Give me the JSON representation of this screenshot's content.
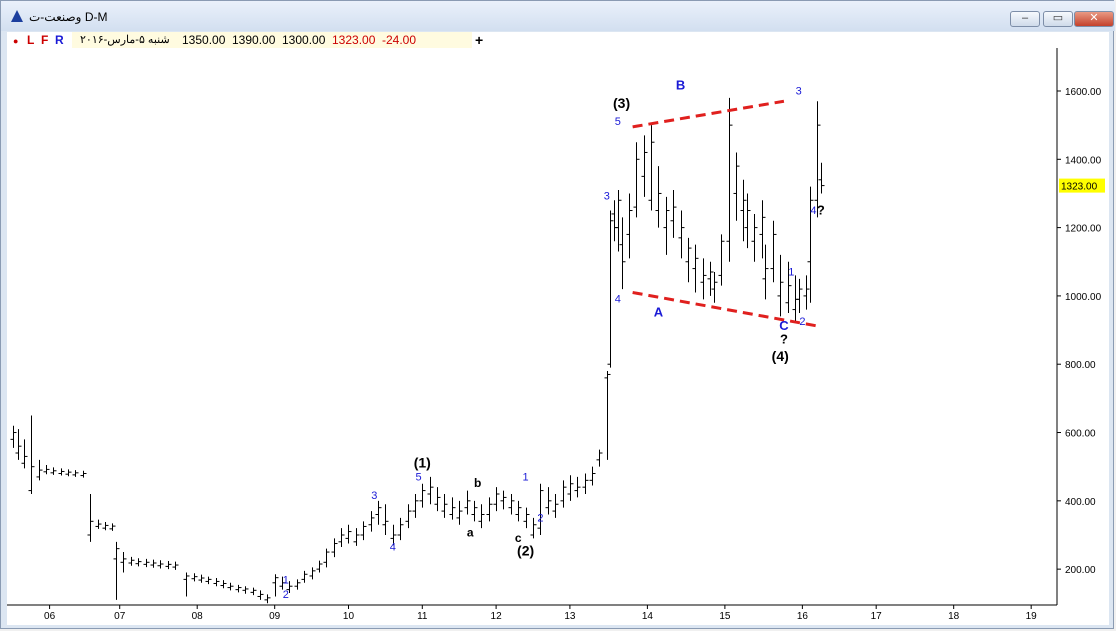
{
  "window": {
    "title": "وصنعت-ت D-M",
    "buttons": [
      "–",
      "▭",
      "✕"
    ]
  },
  "toolbar": {
    "dot": "●",
    "L": "L",
    "F": "F",
    "R": "R",
    "date": "شنبه ۵-مارس-۲۰۱۶",
    "open": "1350.00",
    "high": "1390.00",
    "low": "1300.00",
    "close": "1323.00",
    "change": "-24.00",
    "add": "+"
  },
  "colors": {
    "accent_red": "#cc0000",
    "wave_blue": "#1a1ad6",
    "trendline": "#e0201e",
    "price_tag": "#ffff00"
  },
  "chart_data": {
    "type": "ohlc",
    "y_ticks": [
      200,
      400,
      600,
      800,
      1000,
      1200,
      1400,
      1600
    ],
    "y_tick_labels": [
      "200.00",
      "400.00",
      "600.00",
      "800.00",
      "1000.00",
      "1200.00",
      "1400.00",
      "1600.00"
    ],
    "ylim": [
      95,
      1720
    ],
    "x_ticks": [
      {
        "v": 0.55,
        "label": "06"
      },
      {
        "v": 1.5,
        "label": "07"
      },
      {
        "v": 2.55,
        "label": "08"
      },
      {
        "v": 3.6,
        "label": "09"
      },
      {
        "v": 4.6,
        "label": "10"
      },
      {
        "v": 5.6,
        "label": "11"
      },
      {
        "v": 6.6,
        "label": "12"
      },
      {
        "v": 7.6,
        "label": "13"
      },
      {
        "v": 8.65,
        "label": "14"
      },
      {
        "v": 9.7,
        "label": "15"
      },
      {
        "v": 10.75,
        "label": "16"
      },
      {
        "v": 11.75,
        "label": "17"
      },
      {
        "v": 12.8,
        "label": "18"
      },
      {
        "v": 13.85,
        "label": "19"
      }
    ],
    "last_price": "1323.00",
    "bars": [
      [
        0.05,
        580,
        620,
        555,
        600
      ],
      [
        0.12,
        540,
        610,
        520,
        560
      ],
      [
        0.2,
        510,
        580,
        495,
        530
      ],
      [
        0.3,
        430,
        650,
        420,
        500
      ],
      [
        0.4,
        470,
        520,
        460,
        490
      ],
      [
        0.5,
        485,
        505,
        478,
        492
      ],
      [
        0.6,
        482,
        498,
        476,
        488
      ],
      [
        0.7,
        480,
        495,
        474,
        486
      ],
      [
        0.8,
        478,
        492,
        472,
        484
      ],
      [
        0.9,
        476,
        490,
        470,
        482
      ],
      [
        1.0,
        474,
        488,
        468,
        480
      ],
      [
        1.1,
        300,
        420,
        280,
        340
      ],
      [
        1.2,
        325,
        345,
        318,
        332
      ],
      [
        1.3,
        320,
        338,
        314,
        328
      ],
      [
        1.4,
        318,
        334,
        312,
        326
      ],
      [
        1.45,
        230,
        280,
        110,
        260
      ],
      [
        1.55,
        220,
        250,
        190,
        230
      ],
      [
        1.65,
        218,
        236,
        210,
        226
      ],
      [
        1.75,
        216,
        232,
        208,
        222
      ],
      [
        1.85,
        214,
        230,
        206,
        220
      ],
      [
        1.95,
        212,
        228,
        204,
        218
      ],
      [
        2.05,
        210,
        226,
        202,
        215
      ],
      [
        2.15,
        208,
        224,
        200,
        214
      ],
      [
        2.25,
        206,
        222,
        198,
        212
      ],
      [
        2.4,
        170,
        190,
        120,
        180
      ],
      [
        2.5,
        172,
        188,
        164,
        178
      ],
      [
        2.6,
        168,
        184,
        160,
        174
      ],
      [
        2.7,
        164,
        178,
        156,
        170
      ],
      [
        2.8,
        158,
        174,
        150,
        164
      ],
      [
        2.9,
        152,
        168,
        144,
        158
      ],
      [
        3.0,
        146,
        160,
        138,
        150
      ],
      [
        3.1,
        140,
        154,
        132,
        146
      ],
      [
        3.2,
        138,
        150,
        128,
        142
      ],
      [
        3.3,
        132,
        146,
        124,
        138
      ],
      [
        3.4,
        120,
        138,
        110,
        126
      ],
      [
        3.5,
        110,
        126,
        100,
        116
      ],
      [
        3.6,
        160,
        185,
        120,
        175
      ],
      [
        3.7,
        150,
        178,
        140,
        160
      ],
      [
        3.8,
        140,
        165,
        130,
        150
      ],
      [
        3.9,
        150,
        170,
        140,
        160
      ],
      [
        4.0,
        170,
        195,
        160,
        185
      ],
      [
        4.1,
        180,
        205,
        170,
        195
      ],
      [
        4.2,
        200,
        225,
        190,
        215
      ],
      [
        4.3,
        220,
        260,
        205,
        250
      ],
      [
        4.4,
        250,
        290,
        235,
        275
      ],
      [
        4.5,
        280,
        320,
        265,
        300
      ],
      [
        4.6,
        290,
        330,
        275,
        310
      ],
      [
        4.7,
        280,
        320,
        268,
        300
      ],
      [
        4.8,
        300,
        340,
        285,
        325
      ],
      [
        4.9,
        330,
        370,
        310,
        350
      ],
      [
        5.0,
        360,
        400,
        330,
        380
      ],
      [
        5.1,
        330,
        390,
        300,
        340
      ],
      [
        5.2,
        290,
        330,
        270,
        300
      ],
      [
        5.3,
        300,
        350,
        285,
        330
      ],
      [
        5.4,
        340,
        390,
        320,
        370
      ],
      [
        5.5,
        370,
        420,
        350,
        400
      ],
      [
        5.6,
        400,
        450,
        380,
        430
      ],
      [
        5.7,
        420,
        470,
        390,
        440
      ],
      [
        5.8,
        390,
        440,
        370,
        410
      ],
      [
        5.9,
        370,
        420,
        350,
        390
      ],
      [
        6.0,
        360,
        410,
        345,
        380
      ],
      [
        6.1,
        350,
        400,
        330,
        370
      ],
      [
        6.2,
        380,
        430,
        360,
        400
      ],
      [
        6.3,
        360,
        400,
        340,
        380
      ],
      [
        6.4,
        340,
        390,
        320,
        360
      ],
      [
        6.5,
        360,
        410,
        340,
        390
      ],
      [
        6.6,
        390,
        440,
        370,
        420
      ],
      [
        6.7,
        400,
        430,
        375,
        410
      ],
      [
        6.8,
        380,
        420,
        360,
        400
      ],
      [
        6.9,
        360,
        400,
        340,
        380
      ],
      [
        7.0,
        340,
        380,
        320,
        360
      ],
      [
        7.1,
        300,
        350,
        290,
        330
      ],
      [
        7.2,
        320,
        450,
        300,
        430
      ],
      [
        7.3,
        380,
        440,
        360,
        400
      ],
      [
        7.4,
        370,
        420,
        350,
        390
      ],
      [
        7.5,
        400,
        460,
        380,
        440
      ],
      [
        7.6,
        420,
        475,
        400,
        450
      ],
      [
        7.7,
        430,
        470,
        410,
        440
      ],
      [
        7.8,
        440,
        480,
        420,
        460
      ],
      [
        7.9,
        460,
        500,
        445,
        480
      ],
      [
        8.0,
        520,
        550,
        500,
        540
      ],
      [
        8.1,
        760,
        780,
        520,
        770
      ],
      [
        8.15,
        800,
        1250,
        790,
        1220
      ],
      [
        8.2,
        1240,
        1280,
        1160,
        1200
      ],
      [
        8.25,
        1200,
        1310,
        1130,
        1280
      ],
      [
        8.3,
        1150,
        1230,
        1020,
        1100
      ],
      [
        8.4,
        1180,
        1300,
        1110,
        1250
      ],
      [
        8.5,
        1260,
        1450,
        1230,
        1400
      ],
      [
        8.6,
        1350,
        1470,
        1290,
        1420
      ],
      [
        8.7,
        1280,
        1500,
        1250,
        1450
      ],
      [
        8.8,
        1250,
        1380,
        1200,
        1300
      ],
      [
        8.9,
        1200,
        1290,
        1120,
        1250
      ],
      [
        9.0,
        1220,
        1310,
        1170,
        1260
      ],
      [
        9.1,
        1170,
        1250,
        1110,
        1200
      ],
      [
        9.2,
        1100,
        1170,
        1040,
        1140
      ],
      [
        9.3,
        1080,
        1150,
        1010,
        1110
      ],
      [
        9.4,
        1040,
        1110,
        990,
        1060
      ],
      [
        9.5,
        1050,
        1100,
        1000,
        1070
      ],
      [
        9.55,
        1020,
        1070,
        980,
        1040
      ],
      [
        9.65,
        1060,
        1180,
        1030,
        1160
      ],
      [
        9.75,
        1160,
        1580,
        1100,
        1500
      ],
      [
        9.85,
        1300,
        1420,
        1220,
        1380
      ],
      [
        9.95,
        1250,
        1340,
        1160,
        1280
      ],
      [
        10.0,
        1200,
        1300,
        1140,
        1250
      ],
      [
        10.1,
        1160,
        1240,
        1100,
        1200
      ],
      [
        10.2,
        1180,
        1280,
        1110,
        1230
      ],
      [
        10.25,
        1050,
        1150,
        990,
        1080
      ],
      [
        10.35,
        1080,
        1220,
        1040,
        1180
      ],
      [
        10.45,
        1000,
        1120,
        940,
        1040
      ],
      [
        10.55,
        980,
        1100,
        950,
        1030
      ],
      [
        10.65,
        960,
        1060,
        925,
        990
      ],
      [
        10.7,
        990,
        1050,
        950,
        1020
      ],
      [
        10.8,
        1000,
        1060,
        960,
        1020
      ],
      [
        10.85,
        1100,
        1320,
        980,
        1280
      ],
      [
        10.95,
        1280,
        1570,
        1230,
        1500
      ],
      [
        11.0,
        1340,
        1390,
        1300,
        1323
      ]
    ],
    "trendlines": [
      {
        "x1": 8.45,
        "y1": 1495,
        "x2": 10.5,
        "y2": 1570
      },
      {
        "x1": 8.45,
        "y1": 1010,
        "x2": 10.95,
        "y2": 912
      }
    ],
    "annotations": [
      {
        "x": 5.6,
        "y": 498,
        "text": "(1)",
        "color": "black",
        "size": 14,
        "bold": true
      },
      {
        "x": 5.55,
        "y": 460,
        "text": "5",
        "color": "blue",
        "size": 11
      },
      {
        "x": 3.75,
        "y": 115,
        "text": "2",
        "color": "blue",
        "size": 11
      },
      {
        "x": 3.75,
        "y": 158,
        "text": "1",
        "color": "blue",
        "size": 11
      },
      {
        "x": 5.2,
        "y": 255,
        "text": "4",
        "color": "blue",
        "size": 11
      },
      {
        "x": 4.95,
        "y": 405,
        "text": "3",
        "color": "blue",
        "size": 11
      },
      {
        "x": 6.35,
        "y": 440,
        "text": "b",
        "color": "black",
        "size": 12,
        "bold": true
      },
      {
        "x": 6.25,
        "y": 295,
        "text": "a",
        "color": "black",
        "size": 12,
        "bold": true
      },
      {
        "x": 6.9,
        "y": 280,
        "text": "c",
        "color": "black",
        "size": 12,
        "bold": true
      },
      {
        "x": 7.0,
        "y": 240,
        "text": "(2)",
        "color": "black",
        "size": 14,
        "bold": true
      },
      {
        "x": 7.0,
        "y": 460,
        "text": "1",
        "color": "blue",
        "size": 11
      },
      {
        "x": 7.2,
        "y": 340,
        "text": "2",
        "color": "blue",
        "size": 11
      },
      {
        "x": 8.1,
        "y": 1282,
        "text": "3",
        "color": "blue",
        "size": 11
      },
      {
        "x": 8.25,
        "y": 980,
        "text": "4",
        "color": "blue",
        "size": 11
      },
      {
        "x": 8.3,
        "y": 1550,
        "text": "(3)",
        "color": "black",
        "size": 14,
        "bold": true
      },
      {
        "x": 8.25,
        "y": 1500,
        "text": "5",
        "color": "blue",
        "size": 11
      },
      {
        "x": 9.1,
        "y": 1605,
        "text": "B",
        "color": "blue",
        "size": 13,
        "bold": true
      },
      {
        "x": 8.8,
        "y": 940,
        "text": "A",
        "color": "blue",
        "size": 13,
        "bold": true
      },
      {
        "x": 10.5,
        "y": 900,
        "text": "C",
        "color": "blue",
        "size": 13,
        "bold": true
      },
      {
        "x": 10.5,
        "y": 860,
        "text": "?",
        "color": "black",
        "size": 13,
        "bold": true
      },
      {
        "x": 10.45,
        "y": 810,
        "text": "(4)",
        "color": "black",
        "size": 14,
        "bold": true
      },
      {
        "x": 10.6,
        "y": 1060,
        "text": "1",
        "color": "blue",
        "size": 11
      },
      {
        "x": 10.75,
        "y": 915,
        "text": "2",
        "color": "blue",
        "size": 11
      },
      {
        "x": 10.7,
        "y": 1590,
        "text": "3",
        "color": "blue",
        "size": 11
      },
      {
        "x": 10.9,
        "y": 1240,
        "text": "4",
        "color": "blue",
        "size": 11
      },
      {
        "x": 11.0,
        "y": 1238,
        "text": "?",
        "color": "black",
        "size": 13,
        "bold": true
      }
    ]
  }
}
